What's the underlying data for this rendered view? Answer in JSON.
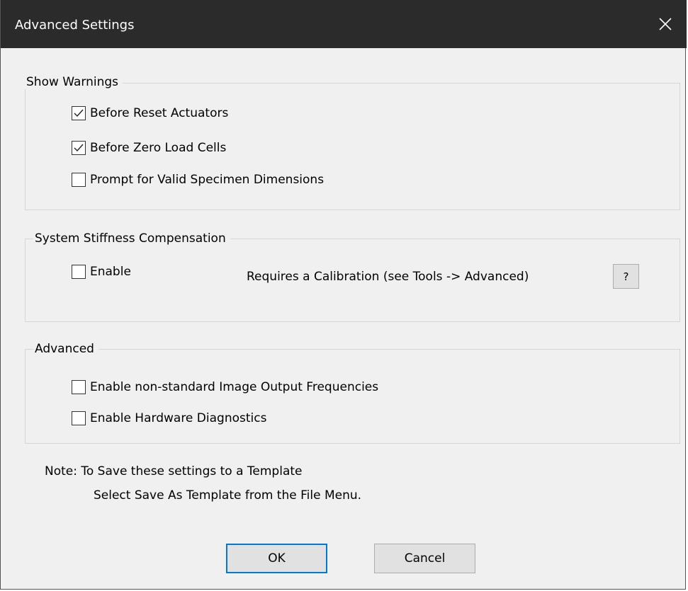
{
  "window": {
    "title": "Advanced Settings",
    "close_icon": "close-icon"
  },
  "show_warnings": {
    "label": "Show Warnings",
    "items": [
      {
        "label": "Before Reset Actuators",
        "checked": true
      },
      {
        "label": "Before Zero Load Cells",
        "checked": true
      },
      {
        "label": "Prompt for Valid Specimen Dimensions",
        "checked": false
      }
    ]
  },
  "stiffness": {
    "label": "System Stiffness Compensation",
    "enable": {
      "label": "Enable",
      "checked": false
    },
    "requirement_text": "Requires a Calibration  (see Tools -> Advanced)",
    "help_label": "?"
  },
  "advanced": {
    "label": "Advanced",
    "items": [
      {
        "label": "Enable non-standard Image Output Frequencies",
        "checked": false
      },
      {
        "label": "Enable Hardware Diagnostics",
        "checked": false
      }
    ]
  },
  "note": {
    "line1": "Note:  To Save these settings to a Template",
    "line2": "Select Save As Template from the File Menu."
  },
  "buttons": {
    "ok_label": "OK",
    "cancel_label": "Cancel"
  },
  "colors": {
    "titlebar": "#2b2b2b",
    "dialog_bg": "#f0f0f0",
    "default_button_border": "#0078d7"
  }
}
